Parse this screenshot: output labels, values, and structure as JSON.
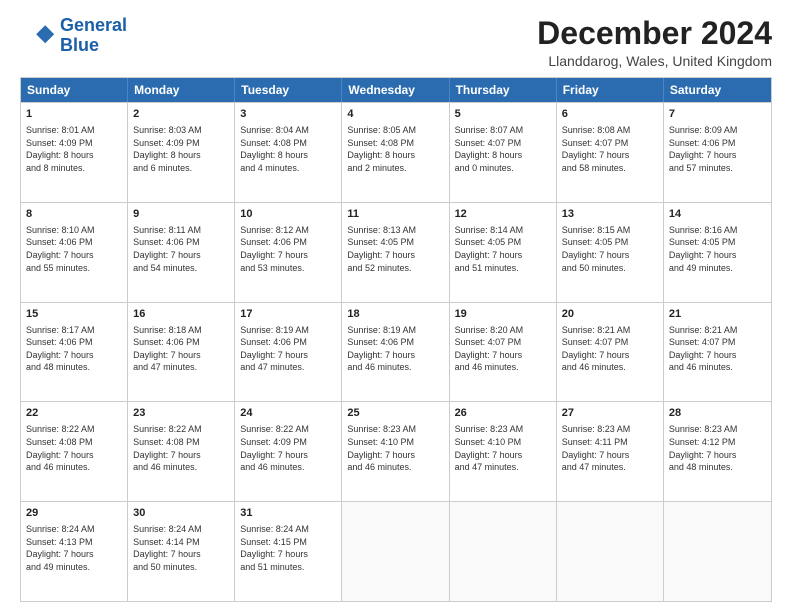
{
  "header": {
    "logo_line1": "General",
    "logo_line2": "Blue",
    "month": "December 2024",
    "location": "Llanddarog, Wales, United Kingdom"
  },
  "weekdays": [
    "Sunday",
    "Monday",
    "Tuesday",
    "Wednesday",
    "Thursday",
    "Friday",
    "Saturday"
  ],
  "weeks": [
    [
      {
        "day": "1",
        "lines": [
          "Sunrise: 8:01 AM",
          "Sunset: 4:09 PM",
          "Daylight: 8 hours",
          "and 8 minutes."
        ]
      },
      {
        "day": "2",
        "lines": [
          "Sunrise: 8:03 AM",
          "Sunset: 4:09 PM",
          "Daylight: 8 hours",
          "and 6 minutes."
        ]
      },
      {
        "day": "3",
        "lines": [
          "Sunrise: 8:04 AM",
          "Sunset: 4:08 PM",
          "Daylight: 8 hours",
          "and 4 minutes."
        ]
      },
      {
        "day": "4",
        "lines": [
          "Sunrise: 8:05 AM",
          "Sunset: 4:08 PM",
          "Daylight: 8 hours",
          "and 2 minutes."
        ]
      },
      {
        "day": "5",
        "lines": [
          "Sunrise: 8:07 AM",
          "Sunset: 4:07 PM",
          "Daylight: 8 hours",
          "and 0 minutes."
        ]
      },
      {
        "day": "6",
        "lines": [
          "Sunrise: 8:08 AM",
          "Sunset: 4:07 PM",
          "Daylight: 7 hours",
          "and 58 minutes."
        ]
      },
      {
        "day": "7",
        "lines": [
          "Sunrise: 8:09 AM",
          "Sunset: 4:06 PM",
          "Daylight: 7 hours",
          "and 57 minutes."
        ]
      }
    ],
    [
      {
        "day": "8",
        "lines": [
          "Sunrise: 8:10 AM",
          "Sunset: 4:06 PM",
          "Daylight: 7 hours",
          "and 55 minutes."
        ]
      },
      {
        "day": "9",
        "lines": [
          "Sunrise: 8:11 AM",
          "Sunset: 4:06 PM",
          "Daylight: 7 hours",
          "and 54 minutes."
        ]
      },
      {
        "day": "10",
        "lines": [
          "Sunrise: 8:12 AM",
          "Sunset: 4:06 PM",
          "Daylight: 7 hours",
          "and 53 minutes."
        ]
      },
      {
        "day": "11",
        "lines": [
          "Sunrise: 8:13 AM",
          "Sunset: 4:05 PM",
          "Daylight: 7 hours",
          "and 52 minutes."
        ]
      },
      {
        "day": "12",
        "lines": [
          "Sunrise: 8:14 AM",
          "Sunset: 4:05 PM",
          "Daylight: 7 hours",
          "and 51 minutes."
        ]
      },
      {
        "day": "13",
        "lines": [
          "Sunrise: 8:15 AM",
          "Sunset: 4:05 PM",
          "Daylight: 7 hours",
          "and 50 minutes."
        ]
      },
      {
        "day": "14",
        "lines": [
          "Sunrise: 8:16 AM",
          "Sunset: 4:05 PM",
          "Daylight: 7 hours",
          "and 49 minutes."
        ]
      }
    ],
    [
      {
        "day": "15",
        "lines": [
          "Sunrise: 8:17 AM",
          "Sunset: 4:06 PM",
          "Daylight: 7 hours",
          "and 48 minutes."
        ]
      },
      {
        "day": "16",
        "lines": [
          "Sunrise: 8:18 AM",
          "Sunset: 4:06 PM",
          "Daylight: 7 hours",
          "and 47 minutes."
        ]
      },
      {
        "day": "17",
        "lines": [
          "Sunrise: 8:19 AM",
          "Sunset: 4:06 PM",
          "Daylight: 7 hours",
          "and 47 minutes."
        ]
      },
      {
        "day": "18",
        "lines": [
          "Sunrise: 8:19 AM",
          "Sunset: 4:06 PM",
          "Daylight: 7 hours",
          "and 46 minutes."
        ]
      },
      {
        "day": "19",
        "lines": [
          "Sunrise: 8:20 AM",
          "Sunset: 4:07 PM",
          "Daylight: 7 hours",
          "and 46 minutes."
        ]
      },
      {
        "day": "20",
        "lines": [
          "Sunrise: 8:21 AM",
          "Sunset: 4:07 PM",
          "Daylight: 7 hours",
          "and 46 minutes."
        ]
      },
      {
        "day": "21",
        "lines": [
          "Sunrise: 8:21 AM",
          "Sunset: 4:07 PM",
          "Daylight: 7 hours",
          "and 46 minutes."
        ]
      }
    ],
    [
      {
        "day": "22",
        "lines": [
          "Sunrise: 8:22 AM",
          "Sunset: 4:08 PM",
          "Daylight: 7 hours",
          "and 46 minutes."
        ]
      },
      {
        "day": "23",
        "lines": [
          "Sunrise: 8:22 AM",
          "Sunset: 4:08 PM",
          "Daylight: 7 hours",
          "and 46 minutes."
        ]
      },
      {
        "day": "24",
        "lines": [
          "Sunrise: 8:22 AM",
          "Sunset: 4:09 PM",
          "Daylight: 7 hours",
          "and 46 minutes."
        ]
      },
      {
        "day": "25",
        "lines": [
          "Sunrise: 8:23 AM",
          "Sunset: 4:10 PM",
          "Daylight: 7 hours",
          "and 46 minutes."
        ]
      },
      {
        "day": "26",
        "lines": [
          "Sunrise: 8:23 AM",
          "Sunset: 4:10 PM",
          "Daylight: 7 hours",
          "and 47 minutes."
        ]
      },
      {
        "day": "27",
        "lines": [
          "Sunrise: 8:23 AM",
          "Sunset: 4:11 PM",
          "Daylight: 7 hours",
          "and 47 minutes."
        ]
      },
      {
        "day": "28",
        "lines": [
          "Sunrise: 8:23 AM",
          "Sunset: 4:12 PM",
          "Daylight: 7 hours",
          "and 48 minutes."
        ]
      }
    ],
    [
      {
        "day": "29",
        "lines": [
          "Sunrise: 8:24 AM",
          "Sunset: 4:13 PM",
          "Daylight: 7 hours",
          "and 49 minutes."
        ]
      },
      {
        "day": "30",
        "lines": [
          "Sunrise: 8:24 AM",
          "Sunset: 4:14 PM",
          "Daylight: 7 hours",
          "and 50 minutes."
        ]
      },
      {
        "day": "31",
        "lines": [
          "Sunrise: 8:24 AM",
          "Sunset: 4:15 PM",
          "Daylight: 7 hours",
          "and 51 minutes."
        ]
      },
      null,
      null,
      null,
      null
    ]
  ]
}
